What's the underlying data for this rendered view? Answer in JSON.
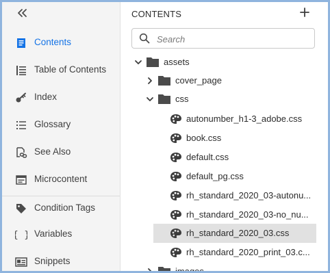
{
  "sidebar": {
    "collapse_icon": "double-chevron-left-icon",
    "items": [
      {
        "label": "Contents",
        "icon": "document-lines-icon",
        "active": true
      },
      {
        "label": "Table of Contents",
        "icon": "toc-icon",
        "active": false
      },
      {
        "label": "Index",
        "icon": "key-icon",
        "active": false
      },
      {
        "label": "Glossary",
        "icon": "bullet-list-icon",
        "active": false
      },
      {
        "label": "See Also",
        "icon": "link-document-icon",
        "active": false
      },
      {
        "label": "Microcontent",
        "icon": "microcontent-icon",
        "active": false
      },
      {
        "label": "Condition Tags",
        "icon": "tag-icon",
        "active": false
      },
      {
        "label": "Variables",
        "icon": "braces-icon",
        "active": false
      },
      {
        "label": "Snippets",
        "icon": "snippet-icon",
        "active": false
      }
    ]
  },
  "panel": {
    "title": "CONTENTS",
    "add_icon": "plus-icon",
    "search_placeholder": "Search"
  },
  "tree": [
    {
      "label": "assets",
      "type": "folder",
      "expanded": true,
      "level": 0
    },
    {
      "label": "cover_page",
      "type": "folder",
      "expanded": false,
      "level": 1
    },
    {
      "label": "css",
      "type": "folder",
      "expanded": true,
      "level": 1
    },
    {
      "label": "autonumber_h1-3_adobe.css",
      "type": "css",
      "level": 2
    },
    {
      "label": "book.css",
      "type": "css",
      "level": 2
    },
    {
      "label": "default.css",
      "type": "css",
      "level": 2
    },
    {
      "label": "default_pg.css",
      "type": "css",
      "level": 2
    },
    {
      "label": "rh_standard_2020_03-autonu...",
      "type": "css",
      "level": 2
    },
    {
      "label": "rh_standard_2020_03-no_nu...",
      "type": "css",
      "level": 2
    },
    {
      "label": "rh_standard_2020_03.css",
      "type": "css",
      "level": 2,
      "selected": true
    },
    {
      "label": "rh_standard_2020_print_03.c...",
      "type": "css",
      "level": 2
    },
    {
      "label": "images",
      "type": "folder",
      "expanded": false,
      "level": 1
    }
  ],
  "colors": {
    "accent": "#1473e6",
    "frame_border": "#8fb4de",
    "rail_bg": "#f4f4f4",
    "selected_bg": "#e1e1e1"
  }
}
